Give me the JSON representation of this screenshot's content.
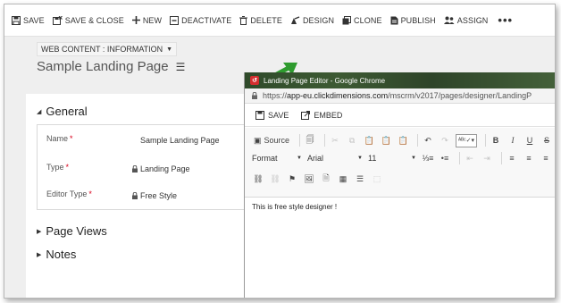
{
  "toolbar": {
    "save": "SAVE",
    "save_close": "SAVE & CLOSE",
    "new": "NEW",
    "deactivate": "DEACTIVATE",
    "delete": "DELETE",
    "design": "DESIGN",
    "clone": "CLONE",
    "publish": "PUBLISH",
    "assign": "ASSIGN",
    "more": "•••"
  },
  "form": {
    "form_type": "WEB CONTENT : INFORMATION",
    "record_title": "Sample Landing Page",
    "sections": {
      "general": "General",
      "page_views": "Page Views",
      "notes": "Notes"
    },
    "fields": [
      {
        "label": "Name",
        "value": "Sample Landing Page",
        "required": "*",
        "locked": false
      },
      {
        "label": "Type",
        "value": "Landing Page",
        "required": "*",
        "locked": true
      },
      {
        "label": "Editor Type",
        "value": "Free Style",
        "required": "*",
        "locked": true
      }
    ]
  },
  "chrome": {
    "window_title": "Landing Page Editor - Google Chrome",
    "url_prefix": "https://",
    "url_host": "app-eu.clickdimensions.com",
    "url_path": "/mscrm/v2017/pages/designer/LandingP"
  },
  "editor": {
    "save": "SAVE",
    "embed": "EMBED",
    "source": "Source",
    "format": "Format",
    "font": "Arial",
    "size": "11",
    "content_text": "This is free style designer !"
  },
  "colors": {
    "arrow": "#2e9b2e",
    "required": "#d9001b",
    "chrome_title_bg": "#2f4a2a"
  }
}
